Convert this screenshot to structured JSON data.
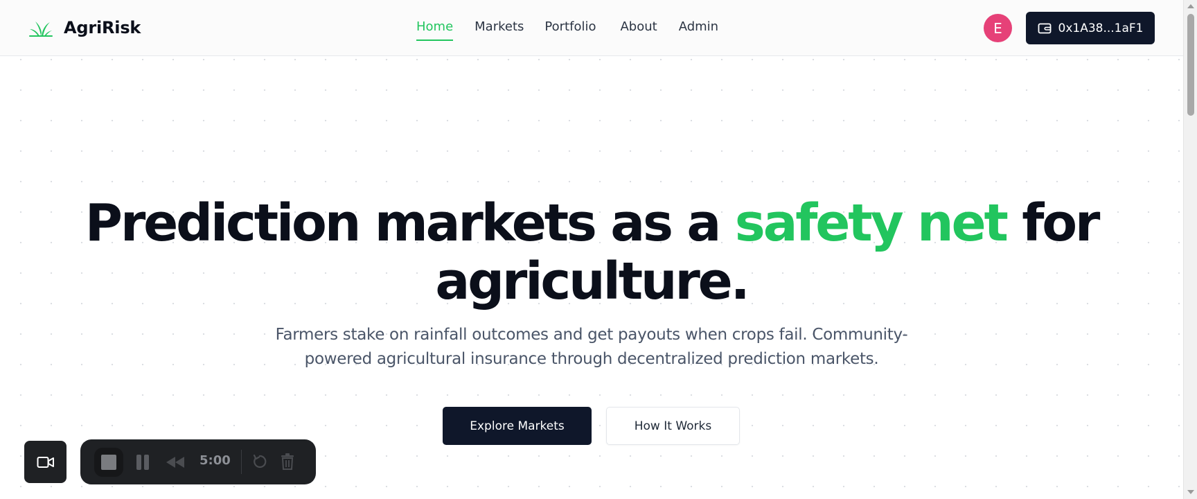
{
  "brand": {
    "name": "AgriRisk",
    "accent_color": "#22c55e",
    "logo_icon": "sprout-icon"
  },
  "nav": {
    "items": [
      {
        "label": "Home",
        "active": true
      },
      {
        "label": "Markets",
        "active": false
      },
      {
        "label": "Portfolio",
        "active": false
      },
      {
        "label": "About",
        "active": false
      },
      {
        "label": "Admin",
        "active": false
      }
    ]
  },
  "user": {
    "avatar_letter": "E",
    "avatar_color": "#e64178"
  },
  "wallet": {
    "icon": "wallet-icon",
    "address": "0x1A38...1aF1"
  },
  "hero": {
    "title_part1": "Prediction markets as a ",
    "title_accent": "safety net",
    "title_part2": " for agriculture.",
    "subtitle": "Farmers stake on rainfall outcomes and get payouts when crops fail. Community-powered agricultural insurance through decentralized prediction markets.",
    "primary_cta": "Explore Markets",
    "secondary_cta": "How It Works"
  },
  "recorder": {
    "camera_icon": "video-camera-icon",
    "stop_icon": "stop-icon",
    "pause_icon": "pause-icon",
    "rewind_icon": "rewind-icon",
    "time": "5:00",
    "restart_icon": "restart-icon",
    "delete_icon": "trash-icon"
  }
}
